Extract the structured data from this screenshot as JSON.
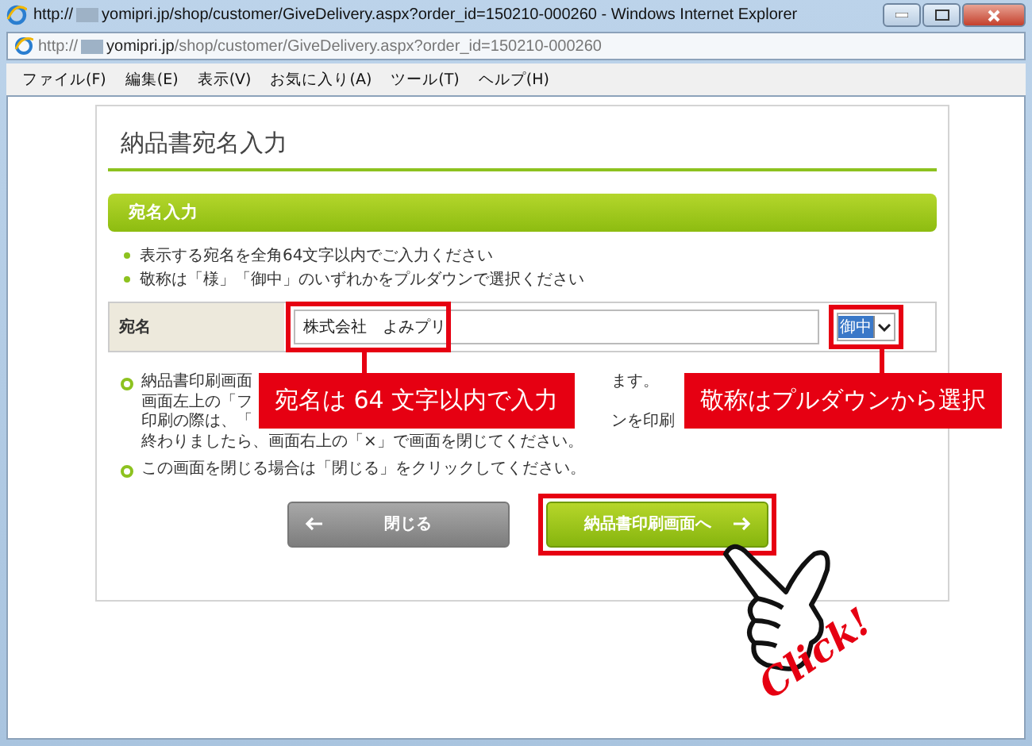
{
  "window": {
    "title_prefix": "http://",
    "title": "yomipri.jp/shop/customer/GiveDelivery.aspx?order_id=150210-000260 - Windows Internet Explorer"
  },
  "address_bar": {
    "scheme": "http://",
    "host": "yomipri.jp",
    "path": "/shop/customer/GiveDelivery.aspx?order_id=150210-000260"
  },
  "menu": [
    "ファイル(F)",
    "編集(E)",
    "表示(V)",
    "お気に入り(A)",
    "ツール(T)",
    "ヘルプ(H)"
  ],
  "page": {
    "heading": "納品書宛名入力",
    "section_title": "宛名入力",
    "instructions": [
      "表示する宛名を全角64文字以内でご入力ください",
      "敬称は「様」「御中」のいずれかをプルダウンで選択ください"
    ],
    "form": {
      "label": "宛名",
      "value": "株式会社　よみプリ",
      "honorific": "御中"
    },
    "notes": [
      {
        "lines": [
          {
            "left": "納品書印刷画面",
            "right": "ます。"
          },
          {
            "left": "画面左上の「フ"
          },
          {
            "left": "印刷の際は、「",
            "right": "ンを印刷"
          },
          {
            "left": "終わりましたら、画面右上の「×」で画面を閉じてください。"
          }
        ]
      },
      {
        "lines": [
          {
            "left": "この画面を閉じる場合は「閉じる」をクリックしてください。"
          }
        ]
      }
    ],
    "buttons": [
      {
        "label": "閉じる",
        "kind": "back",
        "highlighted": false
      },
      {
        "label": "納品書印刷画面へ",
        "kind": "forward",
        "highlighted": true
      }
    ]
  },
  "callouts": [
    "宛名は 64 文字以内で入力",
    "敬称はプルダウンから選択"
  ],
  "click_label": "Click!"
}
